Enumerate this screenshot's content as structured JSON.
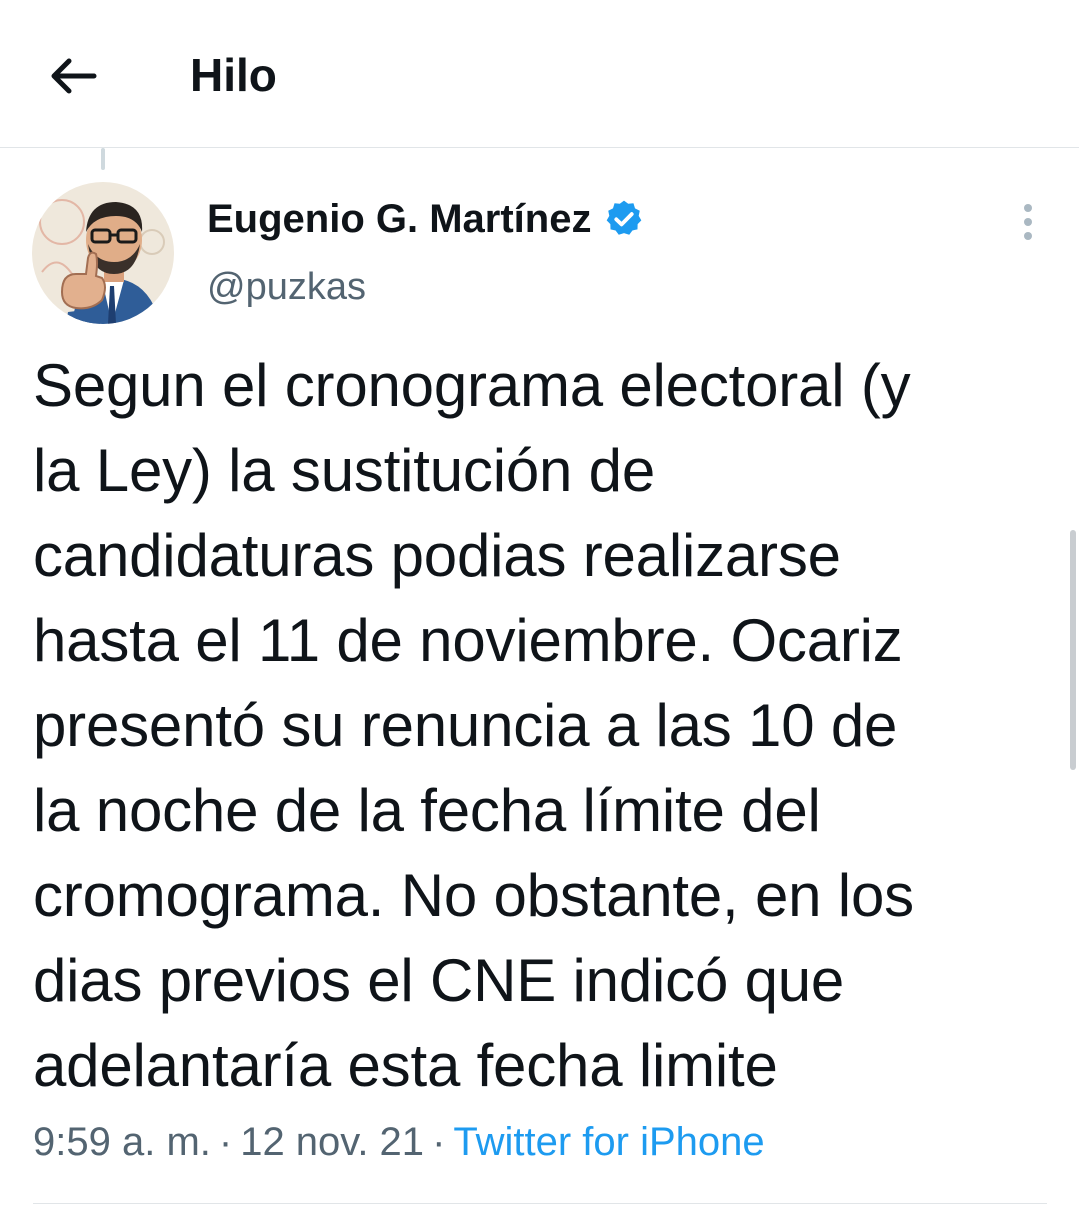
{
  "header": {
    "title": "Hilo",
    "back_icon": "arrow-left-icon"
  },
  "tweet": {
    "author": {
      "name": "Eugenio G. Martínez",
      "handle": "@puzkas",
      "verified": true,
      "verified_icon": "verified-badge-icon"
    },
    "text": "Segun el cronograma electoral (y\nla Ley) la sustitución de\ncandidaturas podias realizarse\nhasta el 11 de noviembre. Ocariz\npresentó su renuncia a las 10 de\nla noche de la fecha límite del\ncromograma. No obstante, en los\ndias previos el CNE indicó que\nadelantaría esta fecha limite",
    "time": "9:59 a. m.",
    "separator": "·",
    "date": "12 nov. 21",
    "source": "Twitter for iPhone",
    "more_icon": "more-vertical-icon"
  },
  "colors": {
    "text_primary": "#0f1419",
    "text_secondary": "#536471",
    "accent": "#1d9bf0",
    "divider": "#e1e5e8"
  }
}
